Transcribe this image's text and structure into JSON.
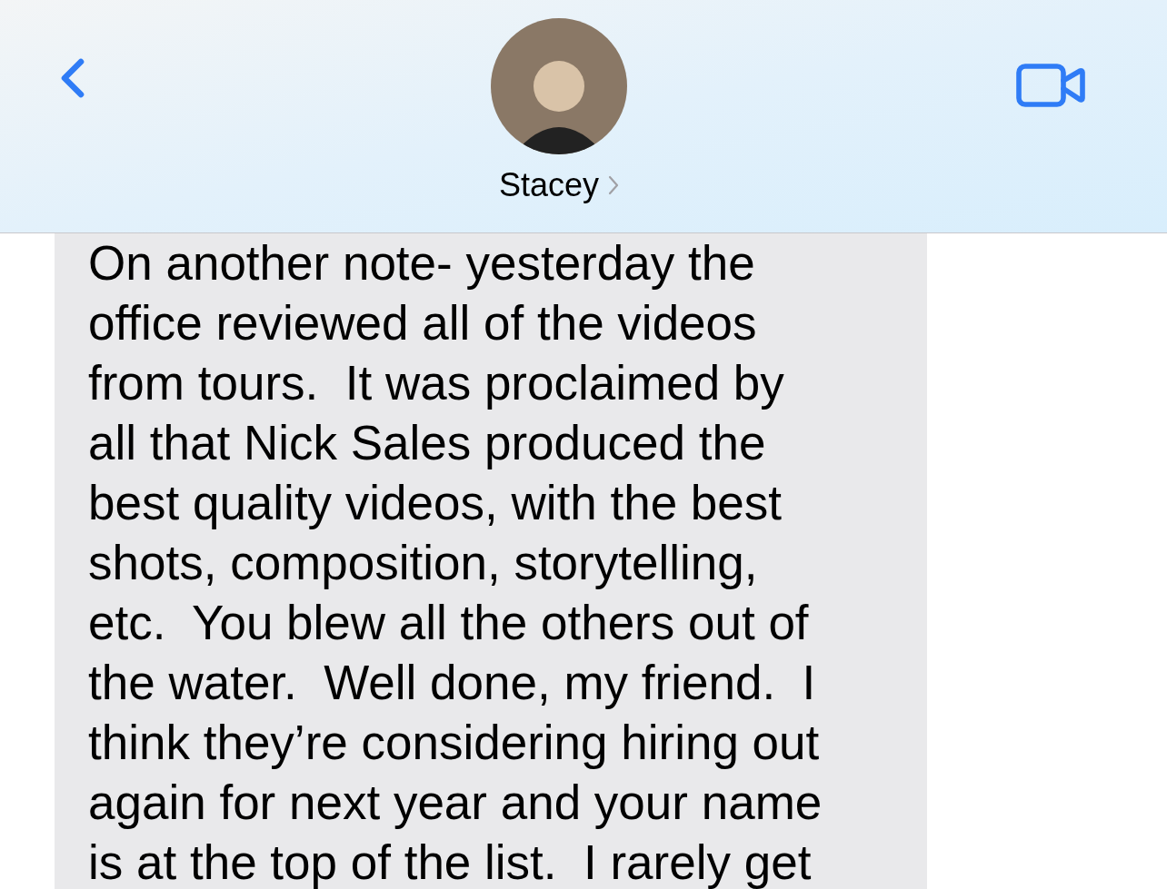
{
  "header": {
    "contact_name": "Stacey"
  },
  "message": {
    "lines": [
      "On another note- yesterday the",
      "office reviewed all of the videos",
      "from tours.  It was proclaimed by",
      "all that Nick Sales produced the",
      "best quality videos, with the best",
      "shots, composition, storytelling,",
      "etc.  You blew all the others out of",
      "the water.  Well done, my friend.  I",
      "think they’re considering hiring out",
      "again for next year and your name",
      "is at the top of the list.  I rarely get"
    ]
  }
}
